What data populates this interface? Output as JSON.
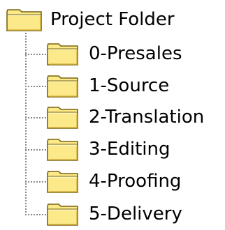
{
  "tree": {
    "root": {
      "label": "Project Folder",
      "icon": "folder-icon"
    },
    "children": [
      {
        "label": "0-Presales",
        "icon": "folder-icon"
      },
      {
        "label": "1-Source",
        "icon": "folder-icon"
      },
      {
        "label": "2-Translation",
        "icon": "folder-icon"
      },
      {
        "label": "3-Editing",
        "icon": "folder-icon"
      },
      {
        "label": "4-Proofing",
        "icon": "folder-icon"
      },
      {
        "label": "5-Delivery",
        "icon": "folder-icon"
      }
    ]
  },
  "colors": {
    "folder_fill": "#fbe98a",
    "folder_outline": "#7a6410",
    "connector": "#8a8a8a"
  }
}
